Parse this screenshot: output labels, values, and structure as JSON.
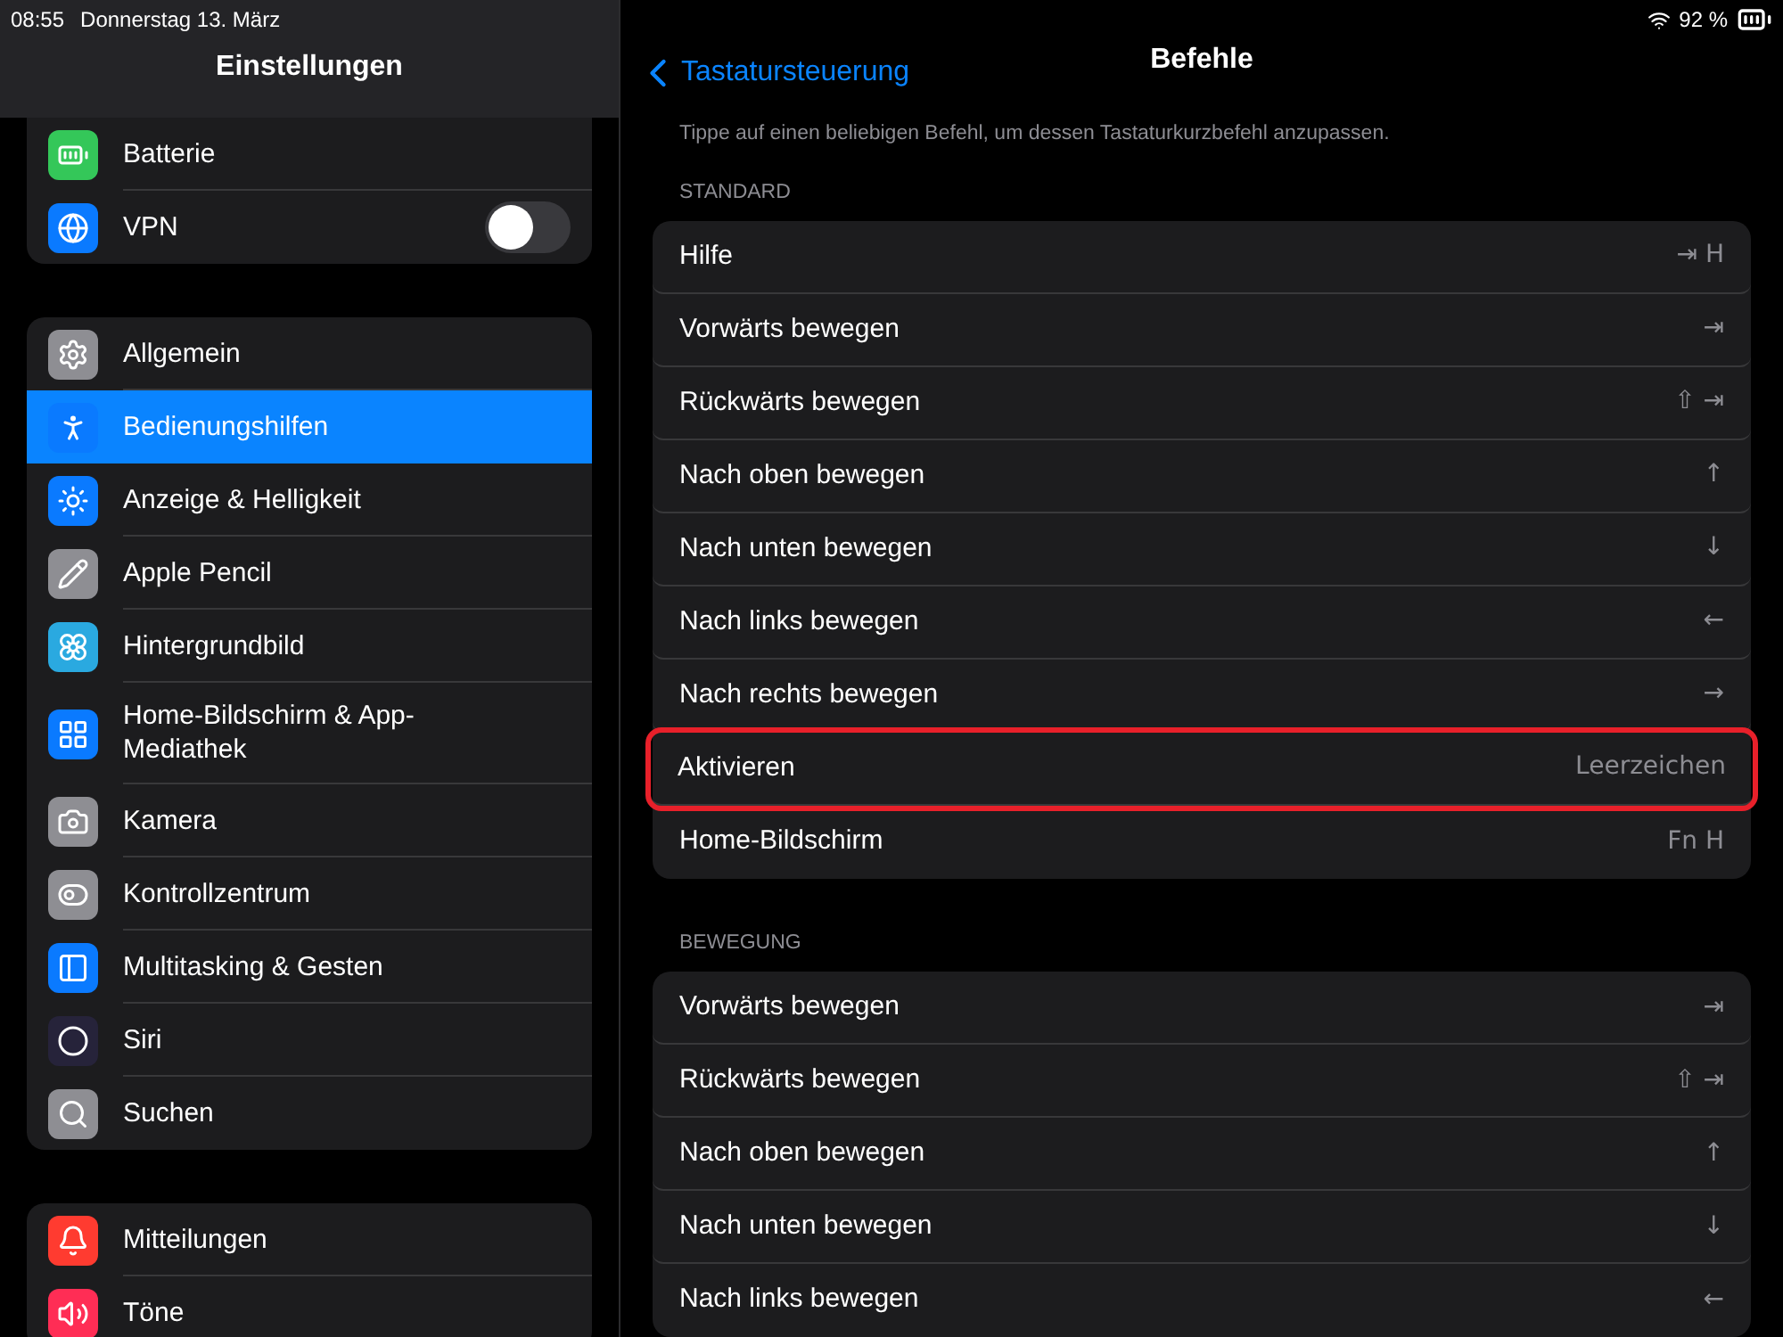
{
  "status_bar": {
    "time": "08:55",
    "date": "Donnerstag 13. März",
    "battery": "92 %"
  },
  "sidebar": {
    "title": "Einstellungen",
    "groups": [
      [
        {
          "label": "Batterie",
          "kind": "link",
          "selected": false,
          "color": "#34c759"
        },
        {
          "label": "VPN",
          "kind": "toggle",
          "on": false,
          "selected": false,
          "color": "#0a7aff"
        }
      ],
      [
        {
          "label": "Allgemein",
          "kind": "link",
          "selected": false,
          "color": "#8e8e93"
        },
        {
          "label": "Bedienungshilfen",
          "kind": "link",
          "selected": true,
          "color": "#0a7aff"
        },
        {
          "label": "Anzeige & Helligkeit",
          "kind": "link",
          "selected": false,
          "color": "#0a7aff"
        },
        {
          "label": "Apple Pencil",
          "kind": "link",
          "selected": false,
          "color": "#8e8e93"
        },
        {
          "label": "Hintergrundbild",
          "kind": "link",
          "selected": false,
          "color": "#2aa9e0"
        },
        {
          "label": "Home-Bildschirm & App-Mediathek",
          "kind": "link",
          "selected": false,
          "color": "#0a7aff"
        },
        {
          "label": "Kamera",
          "kind": "link",
          "selected": false,
          "color": "#8e8e93"
        },
        {
          "label": "Kontrollzentrum",
          "kind": "link",
          "selected": false,
          "color": "#8e8e93"
        },
        {
          "label": "Multitasking & Gesten",
          "kind": "link",
          "selected": false,
          "color": "#0a7aff"
        },
        {
          "label": "Siri",
          "kind": "link",
          "selected": false,
          "color": "#26233a"
        },
        {
          "label": "Suchen",
          "kind": "link",
          "selected": false,
          "color": "#8e8e93"
        }
      ],
      [
        {
          "label": "Mitteilungen",
          "kind": "link",
          "selected": false,
          "color": "#ff3b30"
        },
        {
          "label": "Töne",
          "kind": "link",
          "selected": false,
          "color": "#ff2d55"
        }
      ]
    ]
  },
  "detail": {
    "back": "Tastatursteuerung",
    "title": "Befehle",
    "hint": "Tippe auf einen beliebigen Befehl, um dessen Tastaturkurzbefehl anzupassen.",
    "sections": [
      {
        "header": "STANDARD",
        "rows": [
          {
            "label": "Hilfe",
            "shortcut": "⇥ H",
            "highlighted": false
          },
          {
            "label": "Vorwärts bewegen",
            "shortcut": "⇥",
            "highlighted": false
          },
          {
            "label": "Rückwärts bewegen",
            "shortcut": "⇧ ⇥",
            "highlighted": false
          },
          {
            "label": "Nach oben bewegen",
            "shortcut": "↑",
            "highlighted": false
          },
          {
            "label": "Nach unten bewegen",
            "shortcut": "↓",
            "highlighted": false
          },
          {
            "label": "Nach links bewegen",
            "shortcut": "←",
            "highlighted": false
          },
          {
            "label": "Nach rechts bewegen",
            "shortcut": "→",
            "highlighted": false
          },
          {
            "label": "Aktivieren",
            "shortcut": "Leerzeichen",
            "highlighted": true
          },
          {
            "label": "Home-Bildschirm",
            "shortcut": "Fn H",
            "highlighted": false
          }
        ]
      },
      {
        "header": "BEWEGUNG",
        "rows": [
          {
            "label": "Vorwärts bewegen",
            "shortcut": "⇥",
            "highlighted": false
          },
          {
            "label": "Rückwärts bewegen",
            "shortcut": "⇧ ⇥",
            "highlighted": false
          },
          {
            "label": "Nach oben bewegen",
            "shortcut": "↑",
            "highlighted": false
          },
          {
            "label": "Nach unten bewegen",
            "shortcut": "↓",
            "highlighted": false
          },
          {
            "label": "Nach links bewegen",
            "shortcut": "←",
            "highlighted": false
          }
        ]
      }
    ]
  }
}
